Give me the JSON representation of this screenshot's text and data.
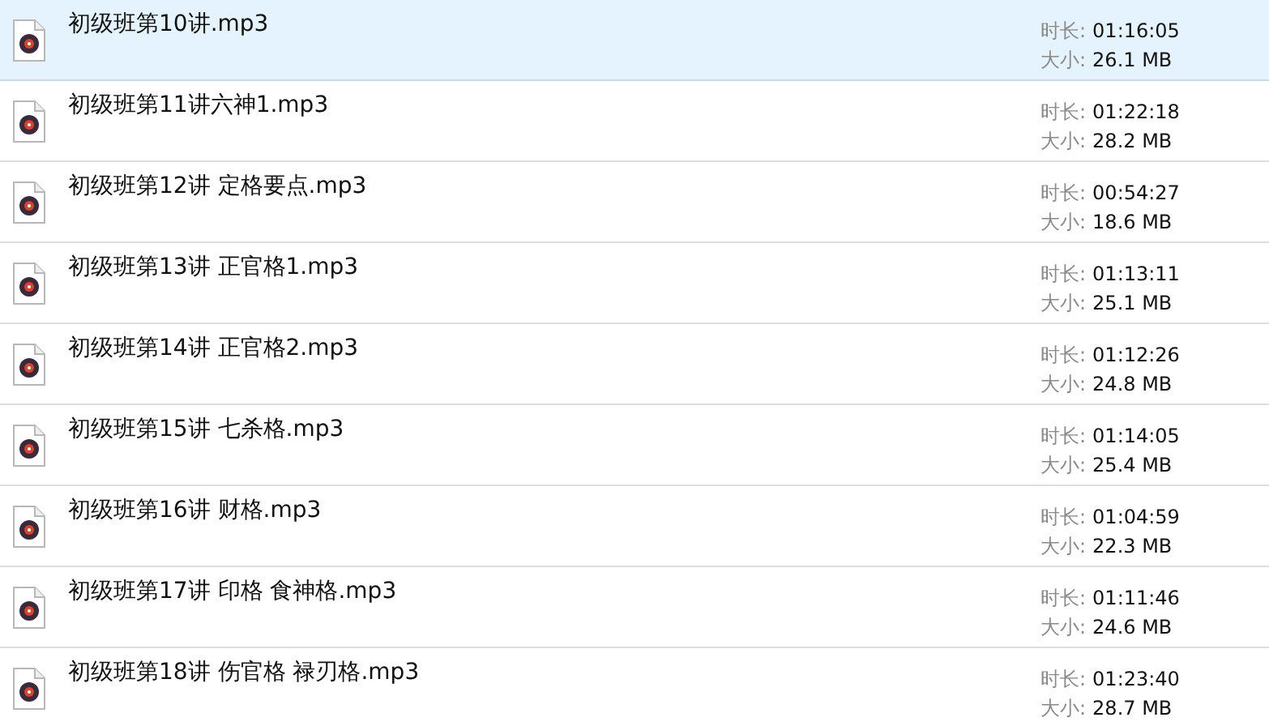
{
  "files": [
    {
      "name": "初级班第10讲.mp3",
      "duration_label": "时长:",
      "duration": "01:16:05",
      "size_label": "大小:",
      "size": "26.1 MB",
      "selected": true
    },
    {
      "name": "初级班第11讲六神1.mp3",
      "duration_label": "时长:",
      "duration": "01:22:18",
      "size_label": "大小:",
      "size": "28.2 MB",
      "selected": false
    },
    {
      "name": "初级班第12讲 定格要点.mp3",
      "duration_label": "时长:",
      "duration": "00:54:27",
      "size_label": "大小:",
      "size": "18.6 MB",
      "selected": false
    },
    {
      "name": "初级班第13讲 正官格1.mp3",
      "duration_label": "时长:",
      "duration": "01:13:11",
      "size_label": "大小:",
      "size": "25.1 MB",
      "selected": false
    },
    {
      "name": "初级班第14讲 正官格2.mp3",
      "duration_label": "时长:",
      "duration": "01:12:26",
      "size_label": "大小:",
      "size": "24.8 MB",
      "selected": false
    },
    {
      "name": "初级班第15讲 七杀格.mp3",
      "duration_label": "时长:",
      "duration": "01:14:05",
      "size_label": "大小:",
      "size": "25.4 MB",
      "selected": false
    },
    {
      "name": "初级班第16讲 财格.mp3",
      "duration_label": "时长:",
      "duration": "01:04:59",
      "size_label": "大小:",
      "size": "22.3 MB",
      "selected": false
    },
    {
      "name": "初级班第17讲 印格 食神格.mp3",
      "duration_label": "时长:",
      "duration": "01:11:46",
      "size_label": "大小:",
      "size": "24.6 MB",
      "selected": false
    },
    {
      "name": "初级班第18讲 伤官格 禄刃格.mp3",
      "duration_label": "时长:",
      "duration": "01:23:40",
      "size_label": "大小:",
      "size": "28.7 MB",
      "selected": false
    }
  ]
}
